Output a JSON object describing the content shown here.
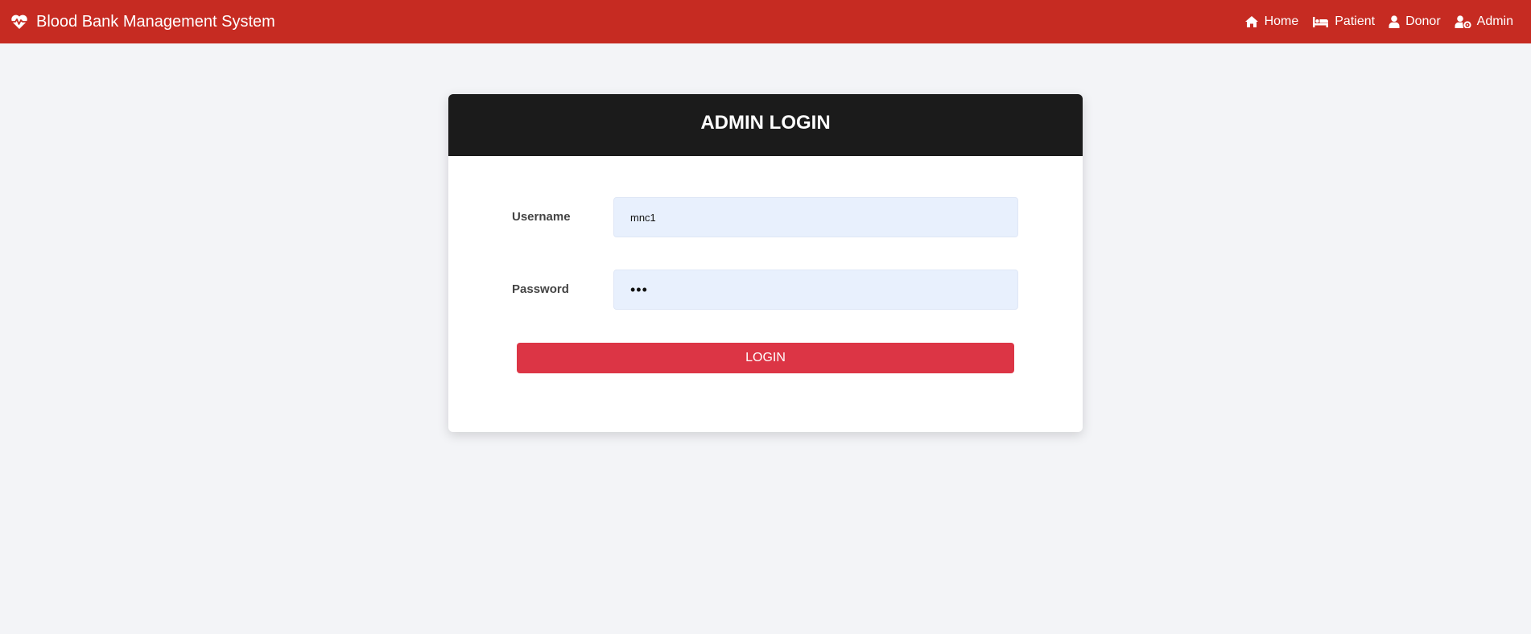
{
  "navbar": {
    "brand_icon": "heart-pulse-icon",
    "title": "Blood Bank Management System",
    "links": [
      {
        "label": "Home",
        "icon": "home-icon"
      },
      {
        "label": "Patient",
        "icon": "hospital-bed-icon"
      },
      {
        "label": "Donor",
        "icon": "user-icon"
      },
      {
        "label": "Admin",
        "icon": "user-cog-icon"
      }
    ]
  },
  "login_card": {
    "title": "ADMIN LOGIN",
    "username_label": "Username",
    "username_value": "mnc1",
    "password_label": "Password",
    "password_value": "•••",
    "login_button_label": "LOGIN"
  },
  "colors": {
    "navbar_bg": "#c62b22",
    "card_header_bg": "#1b1b1b",
    "input_bg": "#e8f0fd",
    "login_button_bg": "#dc3545",
    "page_bg": "#f3f4f7"
  }
}
